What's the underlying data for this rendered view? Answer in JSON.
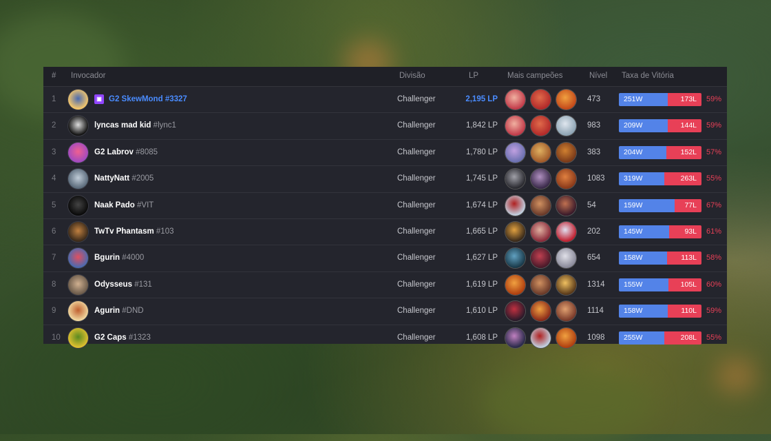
{
  "headers": {
    "rank": "#",
    "summoner": "Invocador",
    "division": "Divisão",
    "lp": "LP",
    "champions": "Mais campeões",
    "level": "Nível",
    "winrate": "Taxa de Vitória"
  },
  "rows": [
    {
      "rank": "1",
      "name": "G2 SkewMond",
      "tag": "#3327",
      "division": "Challenger",
      "lp": "2,195 LP",
      "level": "473",
      "wins": "251W",
      "losses": "173L",
      "win_fraction": 0.592,
      "pct": "59%",
      "twitch": true,
      "twitch_icon": "twitch-icon",
      "avatar": [
        "#f7c86a",
        "#4a6ab0"
      ],
      "champs": [
        [
          "#c23b4a",
          "#f0b0a0"
        ],
        [
          "#b22a2a",
          "#e06a4a"
        ],
        [
          "#c44a1a",
          "#f0a040"
        ]
      ]
    },
    {
      "rank": "2",
      "name": "lyncas mad kid",
      "tag": "#lync1",
      "division": "Challenger",
      "lp": "1,842 LP",
      "level": "983",
      "wins": "209W",
      "losses": "144L",
      "win_fraction": 0.592,
      "pct": "59%",
      "twitch": false,
      "avatar": [
        "#111111",
        "#dddddd"
      ],
      "champs": [
        [
          "#c23b4a",
          "#f0b0a0"
        ],
        [
          "#b22a2a",
          "#e06a4a"
        ],
        [
          "#8ea4b4",
          "#dfe6ee"
        ]
      ]
    },
    {
      "rank": "3",
      "name": "G2 Labrov",
      "tag": "#8085",
      "division": "Challenger",
      "lp": "1,780 LP",
      "level": "383",
      "wins": "204W",
      "losses": "152L",
      "win_fraction": 0.573,
      "pct": "57%",
      "twitch": false,
      "avatar": [
        "#a04ac0",
        "#f06090"
      ],
      "champs": [
        [
          "#6a70b0",
          "#c0a0e0"
        ],
        [
          "#a05a2a",
          "#e0b060"
        ],
        [
          "#7a3a1a",
          "#d08030"
        ]
      ]
    },
    {
      "rank": "4",
      "name": "NattyNatt",
      "tag": "#2005",
      "division": "Challenger",
      "lp": "1,745 LP",
      "level": "1083",
      "wins": "319W",
      "losses": "263L",
      "win_fraction": 0.548,
      "pct": "55%",
      "twitch": false,
      "avatar": [
        "#5a6a7a",
        "#c0ccd8"
      ],
      "champs": [
        [
          "#2a2a30",
          "#a0a0a8"
        ],
        [
          "#3a2a4a",
          "#b090c0"
        ],
        [
          "#8a3a1a",
          "#e08040"
        ]
      ]
    },
    {
      "rank": "5",
      "name": "Naak Pado",
      "tag": "#VIT",
      "division": "Challenger",
      "lp": "1,674 LP",
      "level": "54",
      "wins": "159W",
      "losses": "77L",
      "win_fraction": 0.674,
      "pct": "67%",
      "twitch": false,
      "avatar": [
        "#0a0a0a",
        "#444444"
      ],
      "champs": [
        [
          "#c0d0e0",
          "#b02020"
        ],
        [
          "#6a3a2a",
          "#d09060"
        ],
        [
          "#3a1a2a",
          "#c07050"
        ]
      ]
    },
    {
      "rank": "6",
      "name": "TwTv Phantasm",
      "tag": "#103",
      "division": "Challenger",
      "lp": "1,665 LP",
      "level": "202",
      "wins": "145W",
      "losses": "93L",
      "win_fraction": 0.609,
      "pct": "61%",
      "twitch": false,
      "avatar": [
        "#3a2a1a",
        "#c08040"
      ],
      "champs": [
        [
          "#3a2a1a",
          "#e0a040"
        ],
        [
          "#8a2a3a",
          "#e0b0a0"
        ],
        [
          "#c02030",
          "#e0e0f0"
        ]
      ]
    },
    {
      "rank": "7",
      "name": "Bgurin",
      "tag": "#4000",
      "division": "Challenger",
      "lp": "1,627 LP",
      "level": "654",
      "wins": "158W",
      "losses": "113L",
      "win_fraction": 0.583,
      "pct": "58%",
      "twitch": false,
      "avatar": [
        "#4a6ab0",
        "#e05060"
      ],
      "champs": [
        [
          "#1a3a4a",
          "#60a0c0"
        ],
        [
          "#4a1a2a",
          "#c04050"
        ],
        [
          "#8a8a9a",
          "#e0e0e8"
        ]
      ]
    },
    {
      "rank": "8",
      "name": "Odysseus",
      "tag": "#131",
      "division": "Challenger",
      "lp": "1,619 LP",
      "level": "1314",
      "wins": "155W",
      "losses": "105L",
      "win_fraction": 0.596,
      "pct": "60%",
      "twitch": false,
      "avatar": [
        "#6a5a4a",
        "#d0b090"
      ],
      "champs": [
        [
          "#b04010",
          "#f0a040"
        ],
        [
          "#6a3a2a",
          "#d09060"
        ],
        [
          "#5a3a1a",
          "#f0c060"
        ]
      ]
    },
    {
      "rank": "9",
      "name": "Agurin",
      "tag": "#DND",
      "division": "Challenger",
      "lp": "1,610 LP",
      "level": "1114",
      "wins": "158W",
      "losses": "110L",
      "win_fraction": 0.59,
      "pct": "59%",
      "twitch": false,
      "avatar": [
        "#f0d8a0",
        "#c06030"
      ],
      "champs": [
        [
          "#2a1a2a",
          "#c03040"
        ],
        [
          "#8a2a1a",
          "#f0a040"
        ],
        [
          "#7a3a2a",
          "#e0a070"
        ]
      ]
    },
    {
      "rank": "10",
      "name": "G2 Caps",
      "tag": "#1323",
      "division": "Challenger",
      "lp": "1,608 LP",
      "level": "1098",
      "wins": "255W",
      "losses": "208L",
      "win_fraction": 0.551,
      "pct": "55%",
      "twitch": false,
      "avatar": [
        "#e0c030",
        "#5a8a20"
      ],
      "champs": [
        [
          "#2a2a4a",
          "#c080c0"
        ],
        [
          "#c0d0e0",
          "#b02020"
        ],
        [
          "#b04010",
          "#f0a040"
        ]
      ]
    }
  ],
  "colors": {
    "win_bar": "#5383e8",
    "loss_bar": "#e84057",
    "highlight": "#4a8cff",
    "panel": "#24252d"
  }
}
